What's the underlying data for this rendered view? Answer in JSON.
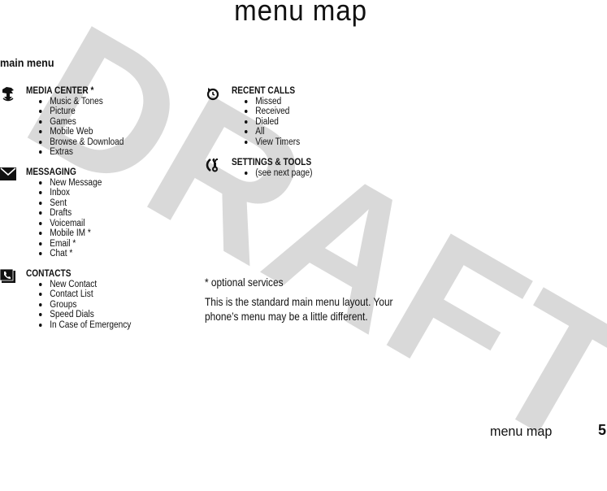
{
  "watermark": "DRAFT",
  "page_title": "menu map",
  "section_title": "main menu",
  "groups": {
    "media": {
      "icon": "media-center-icon",
      "heading": "MEDIA CENTER *",
      "items": [
        "Music & Tones",
        "Picture",
        "Games",
        "Mobile Web",
        "Browse & Download",
        "Extras"
      ]
    },
    "messaging": {
      "icon": "envelope-icon",
      "heading": "MESSAGING",
      "items": [
        "New Message",
        "Inbox",
        "Sent",
        "Drafts",
        "Voicemail",
        "Mobile IM *",
        "Email *",
        "Chat *"
      ]
    },
    "contacts": {
      "icon": "phonebook-icon",
      "heading": "CONTACTS",
      "items": [
        "New Contact",
        "Contact List",
        "Groups",
        "Speed Dials",
        "In Case of Emergency"
      ]
    },
    "recent": {
      "icon": "recent-calls-clock-icon",
      "heading": "RECENT CALLS",
      "items": [
        "Missed",
        "Received",
        "Dialed",
        "All",
        "View Timers"
      ]
    },
    "settings": {
      "icon": "settings-tools-icon",
      "heading": "SETTINGS & TOOLS",
      "items": [
        "(see next page)"
      ]
    }
  },
  "footnote": "* optional services",
  "description_line1": "This is the standard main menu layout. Your",
  "description_line2": "phone’s menu may be a little different.",
  "footer": {
    "label": "menu map",
    "page_number": "5"
  }
}
